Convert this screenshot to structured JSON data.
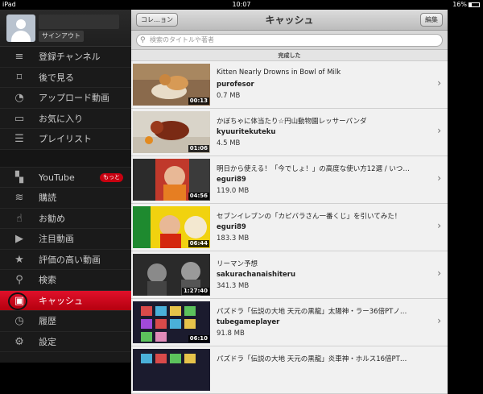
{
  "status_bar": {
    "device": "iPad",
    "time": "10:07",
    "battery": "16%"
  },
  "sidebar": {
    "signout_label": "サインアウト",
    "items": [
      {
        "label": "登録チャンネル",
        "icon": "subscriptions-icon"
      },
      {
        "label": "後で見る",
        "icon": "bookmark-icon"
      },
      {
        "label": "アップロード動画",
        "icon": "upload-icon"
      },
      {
        "label": "お気に入り",
        "icon": "book-icon"
      },
      {
        "label": "プレイリスト",
        "icon": "list-icon"
      }
    ],
    "youtube_label": "YouTube",
    "more_label": "もっと",
    "items2": [
      {
        "label": "購読",
        "icon": "rss-icon"
      },
      {
        "label": "お勧め",
        "icon": "thumbs-up-icon"
      },
      {
        "label": "注目動画",
        "icon": "play-circle-icon"
      },
      {
        "label": "評価の高い動画",
        "icon": "star-icon"
      },
      {
        "label": "検索",
        "icon": "search-icon"
      },
      {
        "label": "キャッシュ",
        "icon": "cache-icon"
      },
      {
        "label": "履歴",
        "icon": "clock-icon"
      },
      {
        "label": "設定",
        "icon": "gear-icon"
      }
    ]
  },
  "navbar": {
    "left_button": "コレ…ョン",
    "title": "キャッシュ",
    "right_button": "編集"
  },
  "search": {
    "placeholder": "検索のタイトルや著者"
  },
  "section_header": "完成した",
  "videos": [
    {
      "title": "Kitten Nearly Drowns in Bowl of Milk",
      "channel": "purofesor",
      "size": "0.7 MB",
      "duration": "00:13"
    },
    {
      "title": "かぼちゃに体当たり☆円山動物園レッサーパンダ",
      "channel": "kyuuritekuteku",
      "size": "4.5 MB",
      "duration": "01:06"
    },
    {
      "title": "明日から使える！「今でしょ！」の高度な使い方12選 / いつ…",
      "channel": "eguri89",
      "size": "119.0 MB",
      "duration": "04:56"
    },
    {
      "title": "セブンイレブンの「カピバラさん一番くじ」を引いてみた！",
      "channel": "eguri89",
      "size": "183.3 MB",
      "duration": "06:44"
    },
    {
      "title": "リーマン予想",
      "channel": "sakurachanaishiteru",
      "size": "341.3 MB",
      "duration": "1:27:40"
    },
    {
      "title": "パズドラ「伝説の大地 天元の黒龍」太陽神・ラー36倍PTノ…",
      "channel": "tubegameplayer",
      "size": "91.8 MB",
      "duration": "06:10"
    },
    {
      "title": "パズドラ「伝説の大地 天元の黒龍」炎車神・ホルス16倍PT…",
      "channel": "",
      "size": "",
      "duration": ""
    }
  ]
}
